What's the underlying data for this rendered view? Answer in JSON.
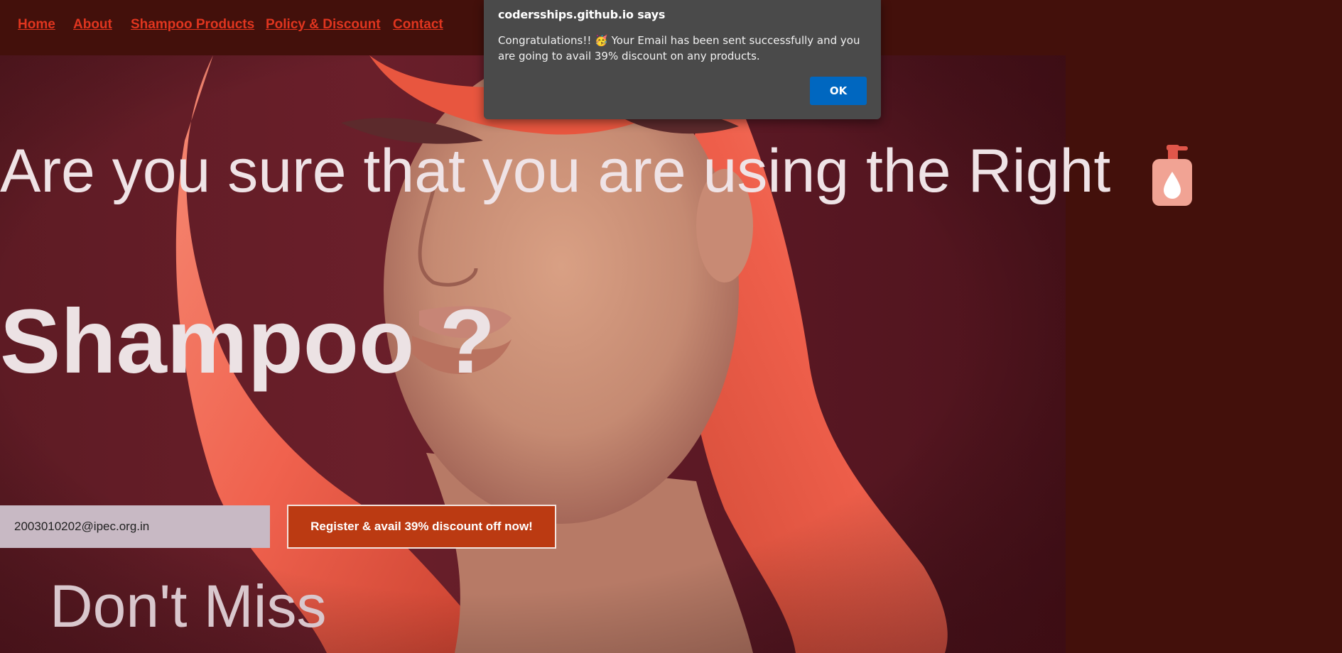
{
  "nav": {
    "items": [
      {
        "label": "Home"
      },
      {
        "label": "About"
      },
      {
        "label": "Shampoo Products"
      },
      {
        "label": "Policy & Discount"
      },
      {
        "label": "Contact"
      }
    ]
  },
  "hero": {
    "headline": "Are you sure that you are using the Right",
    "headline_icon": "lotion-bottle-icon",
    "headline_2": "Shampoo ?",
    "tagline": "Don't Miss"
  },
  "form": {
    "email_value": "2003010202@ipec.org.in",
    "button_label": "Register & avail 39% discount off now!"
  },
  "alert": {
    "title": "codersships.github.io says",
    "message": "Congratulations!! 🥳 Your Email has been sent successfully and you are going to avail 39% discount on any products.",
    "ok_label": "OK"
  },
  "colors": {
    "page_bg": "#43100b",
    "nav_link": "#e0351f",
    "button_bg": "#bb3a12",
    "alert_bg": "#4a4a4a",
    "ok_button": "#0067c0",
    "hair": "#f0624e"
  }
}
